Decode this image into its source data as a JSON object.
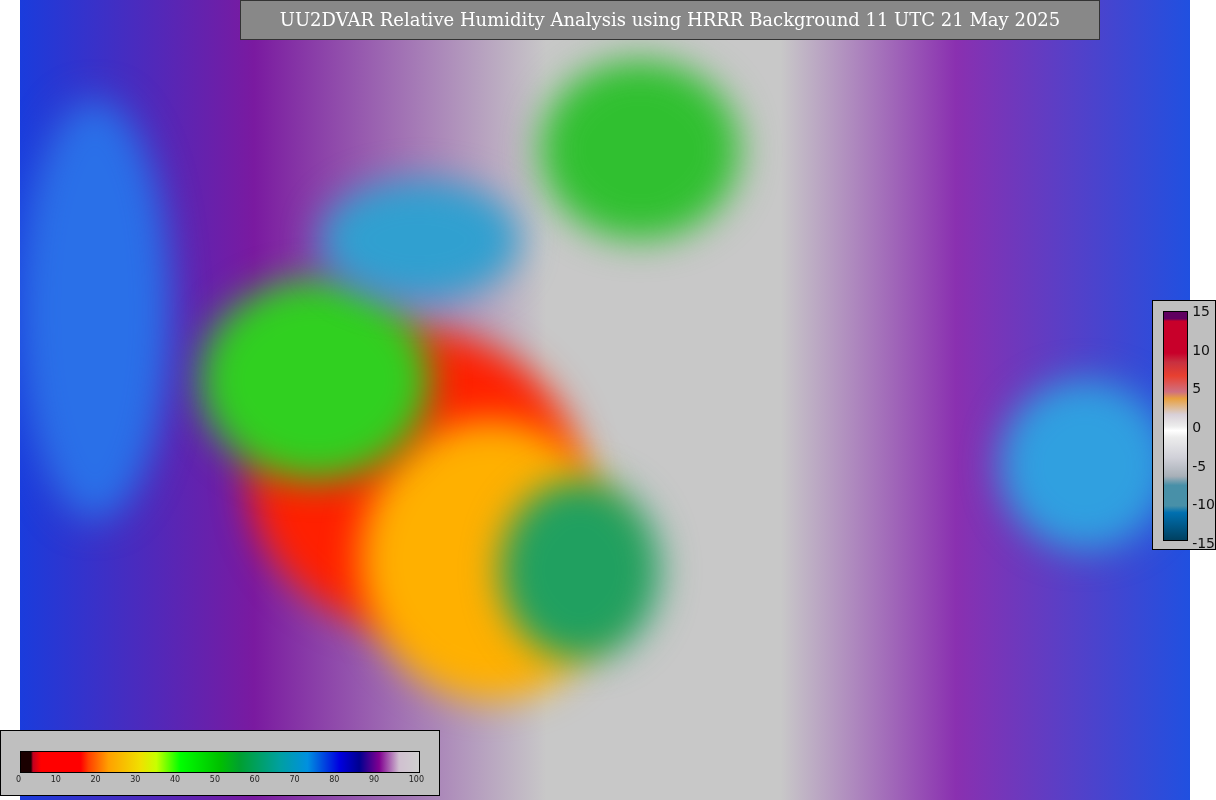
{
  "title": "UU2DVAR Relative Humidity Analysis using HRRR Background 11 UTC 21 May 2025",
  "humidity_legend": {
    "ticks": [
      "0",
      "10",
      "20",
      "30",
      "40",
      "50",
      "60",
      "70",
      "80",
      "90",
      "100"
    ]
  },
  "difference_legend": {
    "ticks": [
      "15",
      "10",
      "5",
      "0",
      "-5",
      "-10",
      "-15"
    ]
  }
}
